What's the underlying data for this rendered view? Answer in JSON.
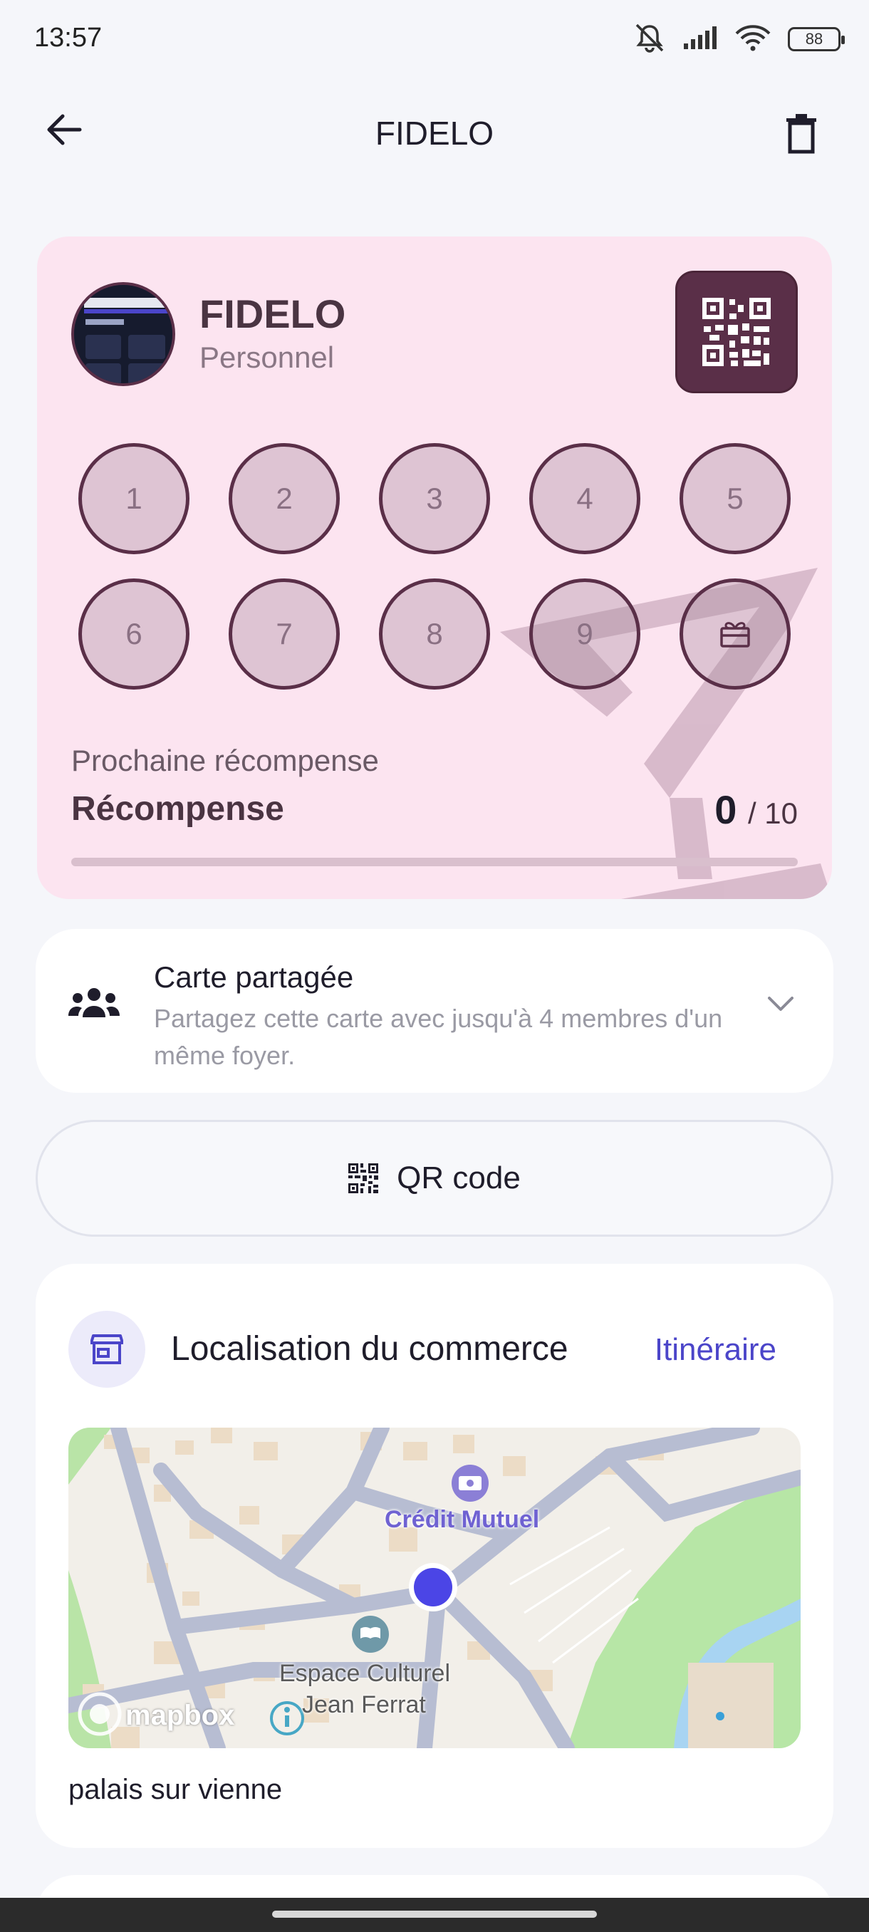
{
  "status_bar": {
    "time": "13:57",
    "battery": "88"
  },
  "app_bar": {
    "title": "FIDELO"
  },
  "loyalty_card": {
    "name": "FIDELO",
    "subtitle": "Personnel",
    "stamps": [
      "1",
      "2",
      "3",
      "4",
      "5",
      "6",
      "7",
      "8",
      "9"
    ],
    "stamps_collected": 0,
    "next_reward_label": "Prochaine récompense",
    "next_reward_name": "Récompense",
    "count": "0",
    "total": "/ 10",
    "progress_fraction": 0.0,
    "accent_color": "#5a2f48",
    "background_color": "#fce4f0"
  },
  "shared_card": {
    "title": "Carte partagée",
    "description": "Partagez cette carte avec jusqu'à 4 membres d'un même foyer."
  },
  "qr_button": {
    "label": "QR code"
  },
  "location": {
    "title": "Localisation du commerce",
    "directions_label": "Itinéraire",
    "map": {
      "poi_bank": "Crédit Mutuel",
      "poi_culture_line1": "Espace Culturel",
      "poi_culture_line2": "Jean Ferrat",
      "attribution": "mapbox"
    },
    "address": "palais sur vienne"
  },
  "colors": {
    "link": "#4b45c9",
    "marker": "#4b45e6"
  }
}
